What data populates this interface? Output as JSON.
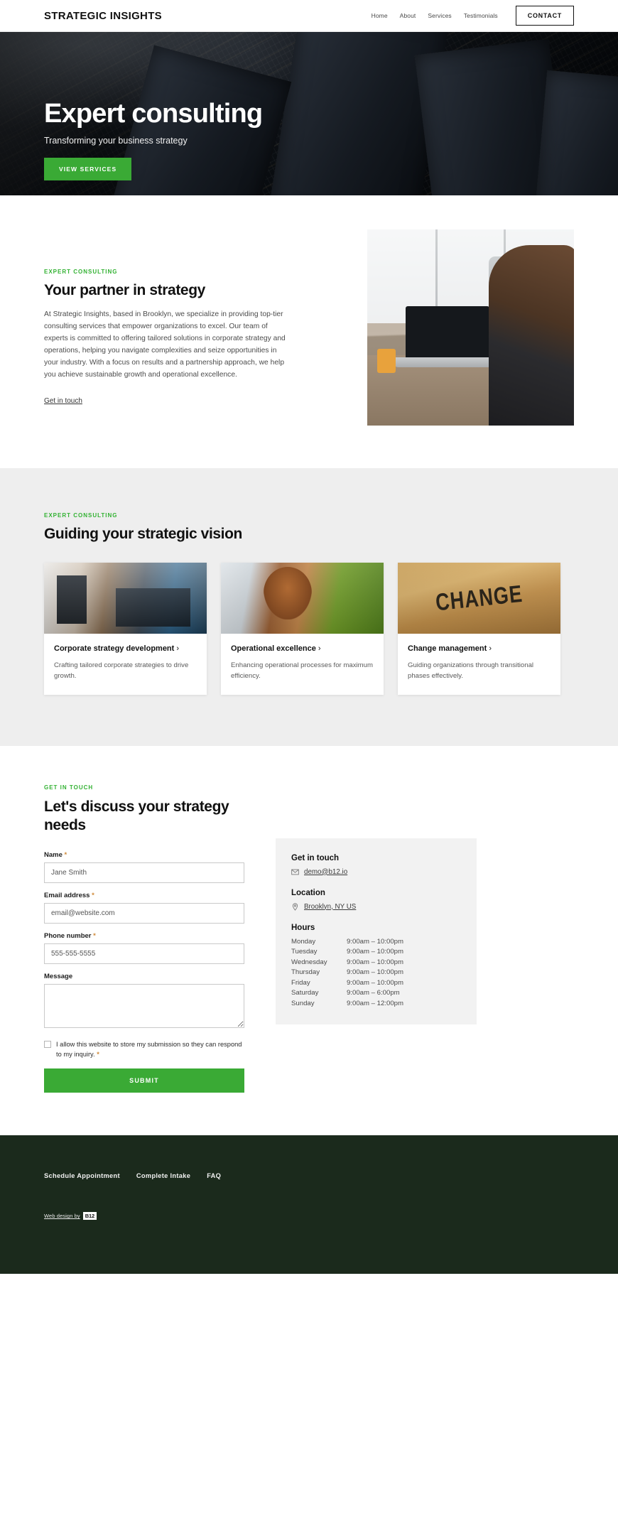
{
  "header": {
    "brand": "STRATEGIC INSIGHTS",
    "nav": [
      {
        "label": "Home"
      },
      {
        "label": "About"
      },
      {
        "label": "Services"
      },
      {
        "label": "Testimonials"
      }
    ],
    "cta_label": "CONTACT"
  },
  "hero": {
    "title": "Expert consulting",
    "subtitle": "Transforming your business strategy",
    "cta_label": "VIEW SERVICES",
    "accent_color": "#3aaa35"
  },
  "about": {
    "eyebrow": "EXPERT CONSULTING",
    "title": "Your partner in strategy",
    "body": "At Strategic Insights, based in Brooklyn, we specialize in providing top-tier consulting services that empower organizations to excel. Our team of experts is committed to offering tailored solutions in corporate strategy and operations, helping you navigate complexities and seize opportunities in your industry. With a focus on results and a partnership approach, we help you achieve sustainable growth and operational excellence.",
    "link_label": "Get in touch"
  },
  "services": {
    "eyebrow": "EXPERT CONSULTING",
    "title": "Guiding your strategic vision",
    "cards": [
      {
        "title": "Corporate strategy development",
        "chevron": "›",
        "desc": "Crafting tailored corporate strategies to drive growth.",
        "image_word": ""
      },
      {
        "title": "Operational excellence",
        "chevron": "›",
        "desc": "Enhancing operational processes for maximum efficiency.",
        "image_word": ""
      },
      {
        "title": "Change management",
        "chevron": "›",
        "desc": "Guiding organizations through transitional phases effectively.",
        "image_word": "CHANGE"
      }
    ]
  },
  "contact": {
    "eyebrow": "GET IN TOUCH",
    "title": "Let's discuss your strategy needs",
    "fields": {
      "name_label": "Name",
      "name_value": "Jane Smith",
      "email_label": "Email address",
      "email_value": "email@website.com",
      "phone_label": "Phone number",
      "phone_value": "555-555-5555",
      "message_label": "Message",
      "message_value": ""
    },
    "required_mark": "*",
    "consent_text": "I allow this website to store my submission so they can respond to my inquiry.",
    "submit_label": "SUBMIT",
    "info": {
      "get_in_touch_title": "Get in touch",
      "email": "demo@b12.io",
      "location_title": "Location",
      "location": "Brooklyn, NY US",
      "hours_title": "Hours",
      "hours": [
        {
          "day": "Monday",
          "time": "9:00am  –  10:00pm"
        },
        {
          "day": "Tuesday",
          "time": "9:00am  –  10:00pm"
        },
        {
          "day": "Wednesday",
          "time": "9:00am  –  10:00pm"
        },
        {
          "day": "Thursday",
          "time": "9:00am  –  10:00pm"
        },
        {
          "day": "Friday",
          "time": "9:00am  –  10:00pm"
        },
        {
          "day": "Saturday",
          "time": "9:00am  –   6:00pm"
        },
        {
          "day": "Sunday",
          "time": "9:00am  –  12:00pm"
        }
      ]
    }
  },
  "footer": {
    "links": [
      {
        "label": "Schedule Appointment"
      },
      {
        "label": "Complete Intake"
      },
      {
        "label": "FAQ"
      }
    ],
    "credit_text": "Web design by",
    "credit_badge": "B12",
    "background_color": "#1b2a1c"
  }
}
